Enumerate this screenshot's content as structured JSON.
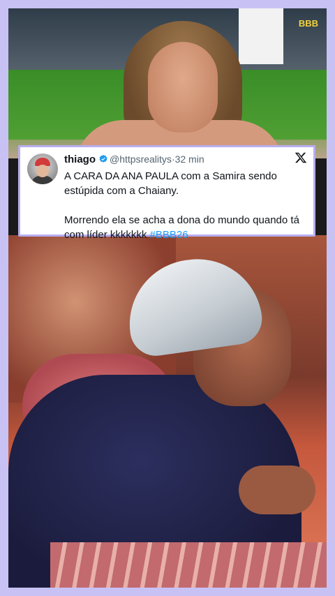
{
  "logo": "BBB",
  "tweet": {
    "name": "thiago",
    "handle": "@httpsrealitys",
    "separator": "·",
    "time": "32 min",
    "line1": "A CARA DA ANA PAULA com a Samira sendo estúpida com a Chaiany.",
    "line2": "Morrendo ela se acha a dona do mundo quando tá com líder kkkkkkk",
    "hashtag": "#BBB26",
    "verified_color": "#1d9bf0"
  },
  "icons": {
    "verified": "verified-badge-icon",
    "platform": "x-logo-icon"
  }
}
